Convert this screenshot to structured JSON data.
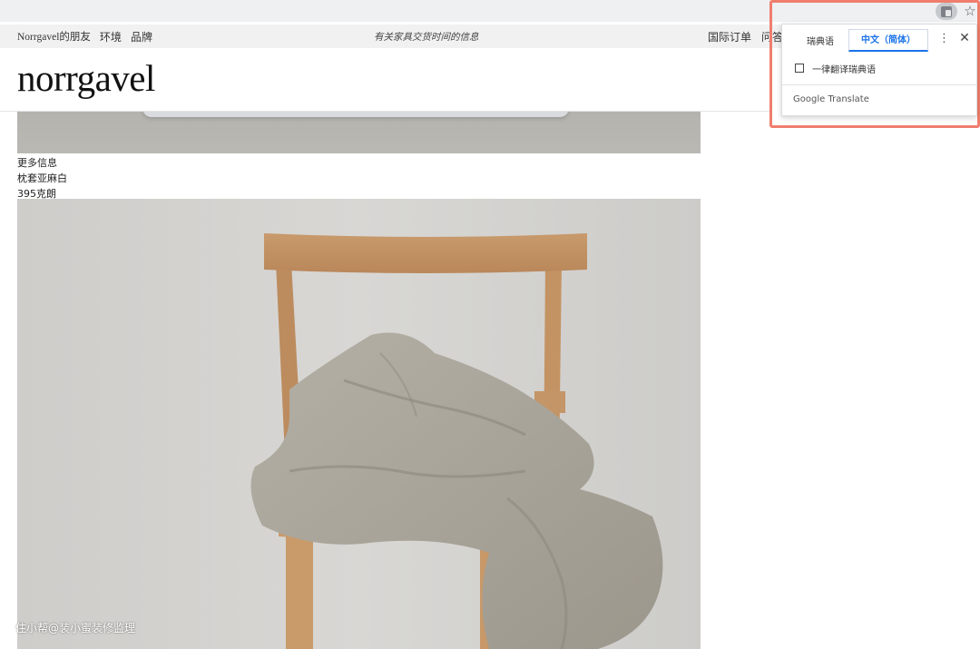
{
  "browser": {
    "translate_icon": "translate-icon",
    "star_icon": "star-icon",
    "star_glyph": "☆"
  },
  "site": {
    "top_nav": [
      "Norrgavel的朋友",
      "环境",
      "品牌"
    ],
    "promo_text": "有关家具交货时间的信息",
    "top_right": [
      "国际订单",
      "问答"
    ],
    "logo": "norrgavel"
  },
  "product": {
    "more_info": "更多信息",
    "item_name": "枕套亚麻白",
    "item_price": "395克朗"
  },
  "watermark": "住小帮@装小蜜装修监理",
  "translate_popup": {
    "source_lang": "瑞典语",
    "target_lang": "中文（简体）",
    "menu_glyph": "⋮",
    "close_glyph": "✕",
    "always_translate_label": "一律翻译瑞典语",
    "always_translate_checked": false,
    "footer": "Google Translate"
  },
  "colors": {
    "highlight_outline": "#f07e6e",
    "accent_blue": "#1a73e8"
  }
}
